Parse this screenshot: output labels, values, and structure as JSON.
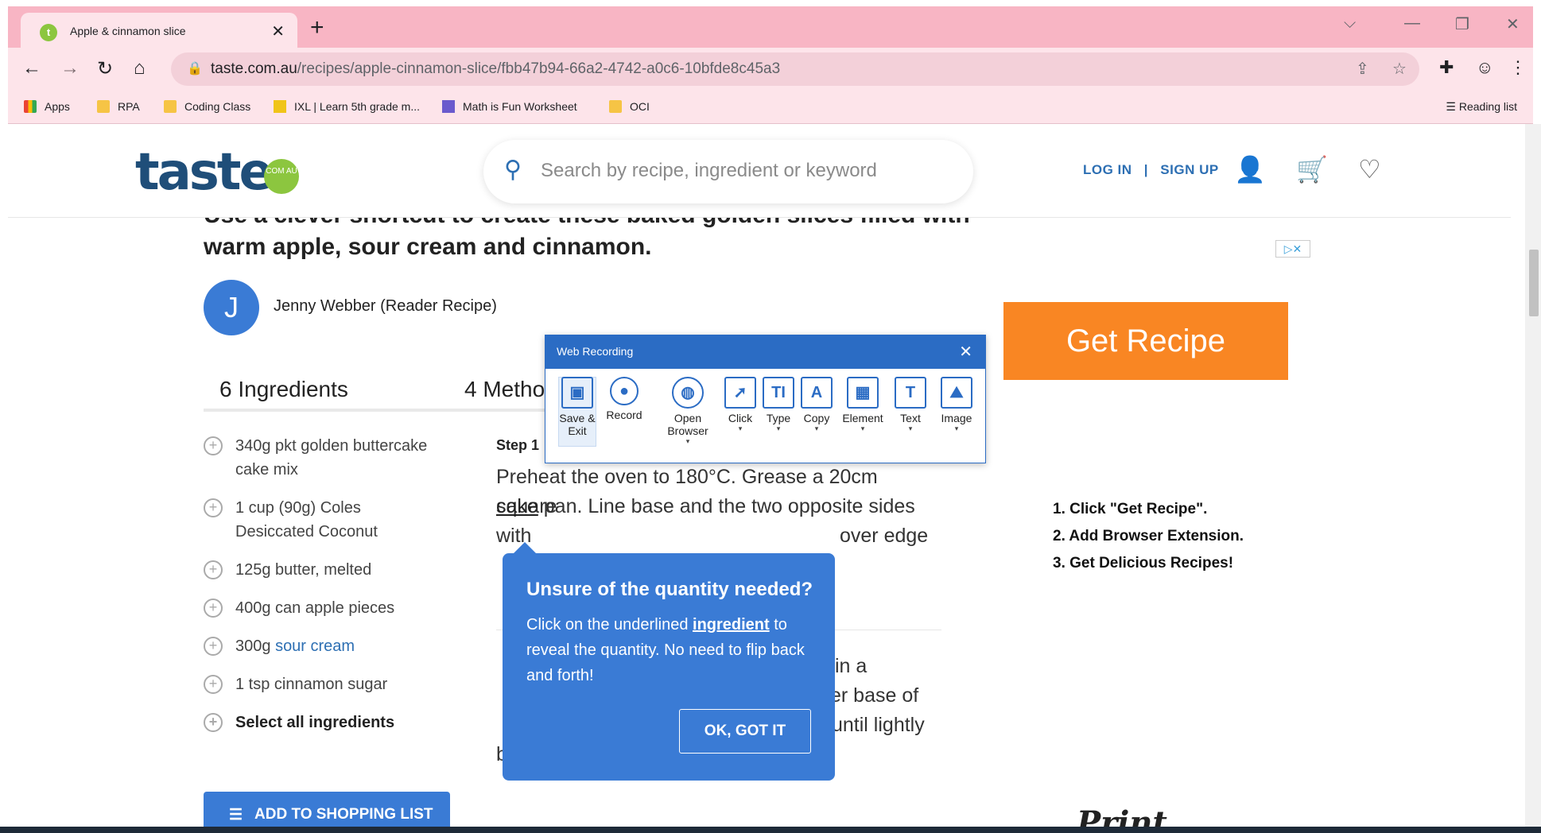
{
  "browser": {
    "tab_title": "Apple & cinnamon slice",
    "tab_favicon": "t",
    "url_domain": "taste.com.au",
    "url_path": "/recipes/apple-cinnamon-slice/fbb47b94-66a2-4742-a0c6-10bfde8c45a3",
    "bookmarks": [
      "Apps",
      "RPA",
      "Coding Class",
      "IXL | Learn 5th grade m...",
      "Math is Fun Worksheet",
      "OCI"
    ],
    "reading_list": "Reading list"
  },
  "site": {
    "logo": "taste",
    "logo_badge": "COM AU",
    "search_placeholder": "Search by recipe, ingredient or keyword",
    "login": "LOG IN",
    "separator": "|",
    "signup": "SIGN UP"
  },
  "recipe": {
    "lead_cut": "Use a clever shortcut to create these baked golden slices filled with",
    "lead": "warm apple, sour cream and cinnamon.",
    "author_initial": "J",
    "author": "Jenny Webber (Reader Recipe)",
    "tab_ingredients": "6 Ingredients",
    "tab_method": "4 Metho",
    "ingredients": [
      "340g pkt golden buttercake cake mix",
      "1 cup (90g) Coles Desiccated Coconut",
      "125g butter, melted",
      "400g can apple pieces",
      "300g ",
      "1 tsp cinnamon sugar"
    ],
    "ingredient_link": "sour cream",
    "select_all": "Select all ingredients",
    "add_to_list": "ADD TO SHOPPING LIST",
    "step1_label": "Step 1",
    "step1_line1": "Preheat the oven to 180°C. Grease a 20cm square",
    "step1_link": "cake",
    "step1_line2": " pan. Line base and the two opposite sides with",
    "step1_line3": "over edge",
    "step2_frag1": "in a",
    "step2_frag2": "er base of",
    "step2_frag3": "until lightly",
    "step2_line4": "browned. Cool slightly."
  },
  "ad": {
    "badge": "▷✕",
    "get_recipe": "Get Recipe",
    "steps": [
      "1. Click  \"Get Recipe\".",
      "2. Add  Browser Extension.",
      "3. Get  Delicious Recipes!"
    ],
    "print": "Print"
  },
  "tooltip": {
    "title": "Unsure of the quantity needed?",
    "body_before": "Click on the underlined ",
    "body_link": "ingredient",
    "body_after": " to reveal the quantity. No need to flip back and forth!",
    "ok": "OK, GOT IT"
  },
  "web_recording": {
    "title": "Web Recording",
    "tools": [
      {
        "label": "Save & Exit",
        "icon": "save-icon"
      },
      {
        "label": "Record",
        "icon": "record-icon"
      },
      {
        "label": "Open Browser",
        "icon": "globe-icon"
      },
      {
        "label": "Click",
        "icon": "click-icon"
      },
      {
        "label": "Type",
        "icon": "type-icon"
      },
      {
        "label": "Copy",
        "icon": "copy-icon"
      },
      {
        "label": "Element",
        "icon": "element-icon"
      },
      {
        "label": "Text",
        "icon": "text-icon"
      },
      {
        "label": "Image",
        "icon": "image-icon"
      }
    ]
  },
  "colors": {
    "chrome_frame": "#f8b5c4",
    "brand_blue": "#3a7bd5",
    "ad_orange": "#f98623",
    "recorder_blue": "#2b6cc4"
  }
}
